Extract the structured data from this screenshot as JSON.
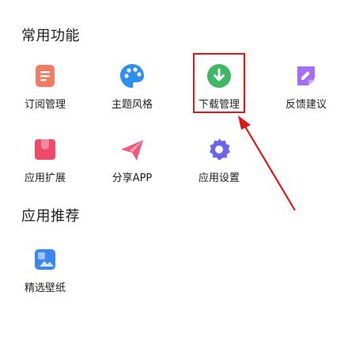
{
  "sections": {
    "common": {
      "title": "常用功能",
      "items": [
        {
          "label": "订阅管理",
          "icon": "subscription-icon",
          "color": "#f07c63"
        },
        {
          "label": "主题风格",
          "icon": "palette-icon",
          "color": "#2f8ff0"
        },
        {
          "label": "下载管理",
          "icon": "download-icon",
          "color": "#3fb765"
        },
        {
          "label": "反馈建议",
          "icon": "feedback-icon",
          "color": "#a56ef5"
        },
        {
          "label": "应用扩展",
          "icon": "extension-icon",
          "color": "#ee4b6a"
        },
        {
          "label": "分享APP",
          "icon": "share-icon",
          "color": "#f05a80"
        },
        {
          "label": "应用设置",
          "icon": "gear-icon",
          "color": "#6b63f2"
        }
      ]
    },
    "recommend": {
      "title": "应用推荐",
      "items": [
        {
          "label": "精选壁纸",
          "icon": "wallpaper-icon",
          "color": "#3b86f0"
        }
      ]
    }
  },
  "highlight": {
    "target": "下载管理",
    "color": "#e0161b"
  }
}
